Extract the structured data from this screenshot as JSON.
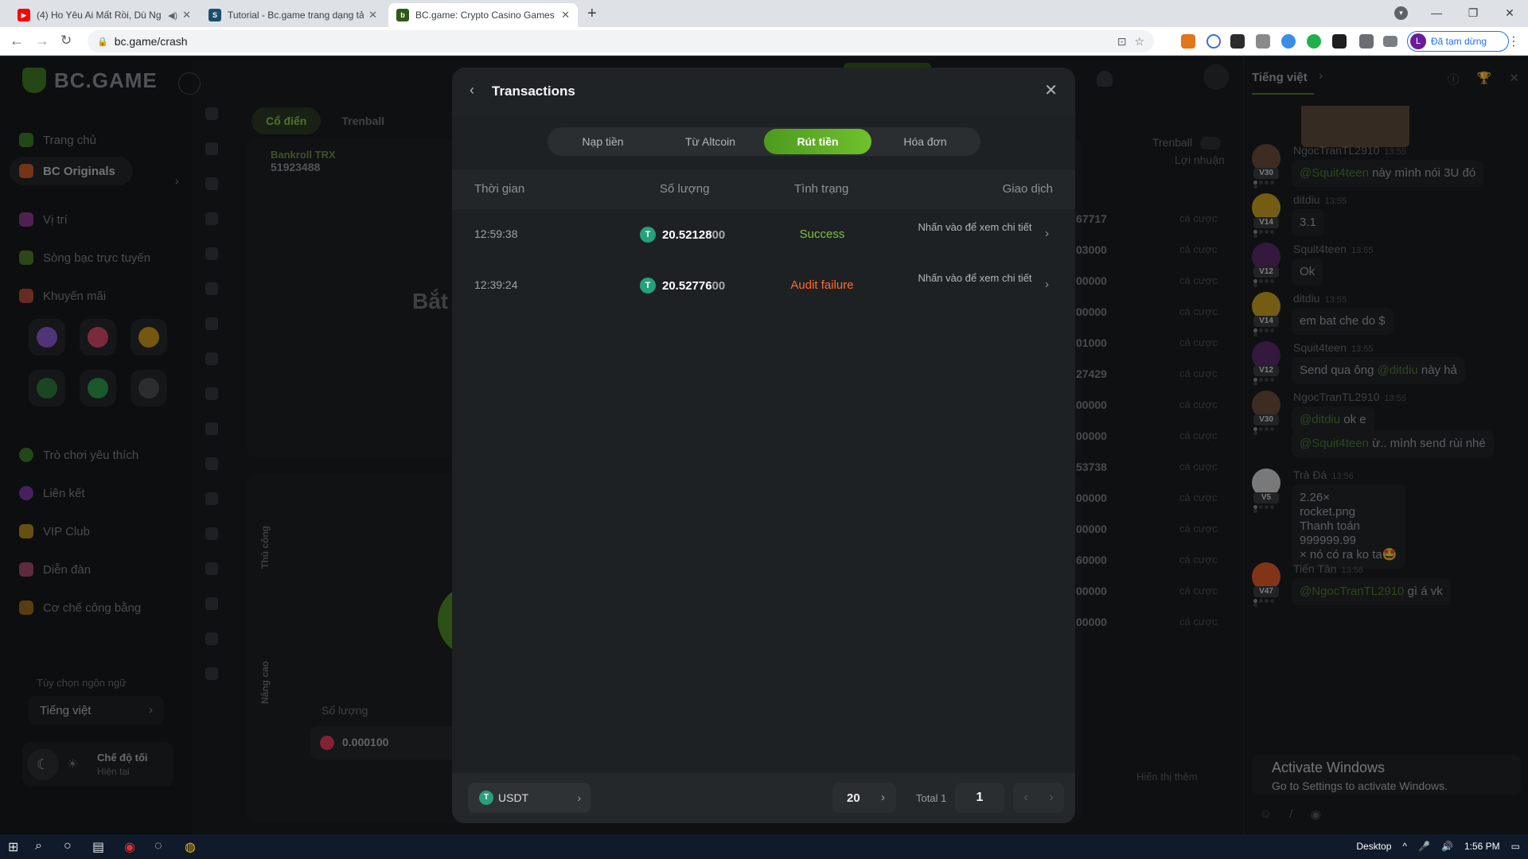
{
  "browser": {
    "tabs": [
      {
        "title": "(4) Ho Yêu Ai Mất Rồi, Dù Ng",
        "favicon_color": "#ff0000",
        "favicon_glyph": "▶"
      },
      {
        "title": "Tutorial - Bc.game trang dạng tả",
        "favicon_color": "#1e4d6b",
        "favicon_glyph": "S"
      },
      {
        "title": "BC.game: Crypto Casino Games &",
        "favicon_color": "#2d5a1b",
        "favicon_glyph": "b"
      }
    ],
    "url": "bc.game/crash",
    "profile_initial": "L",
    "profile_label": "Đã tạm dừng"
  },
  "sidebar": {
    "logo": "BC.GAME",
    "items": [
      {
        "label": "Trang chủ",
        "icon": "home-icon",
        "color": "#3b7d2a"
      },
      {
        "label": "BC Originals",
        "icon": "originals-icon",
        "color": "#c75a28"
      },
      {
        "label": "Vị trí",
        "icon": "slots-icon",
        "color": "#8a3a8a"
      },
      {
        "label": "Sòng bạc trực tuyến",
        "icon": "casino-icon",
        "color": "#4f7a2c"
      },
      {
        "label": "Khuyến mãi",
        "icon": "promo-icon",
        "color": "#b04a3a"
      },
      {
        "label": "Trò chơi yêu thích",
        "icon": "favorite-icon",
        "color": "#3b7d2a"
      },
      {
        "label": "Liên kết",
        "icon": "link-icon",
        "color": "#7a3aa0"
      },
      {
        "label": "VIP Club",
        "icon": "crown-icon",
        "color": "#b08820"
      },
      {
        "label": "Diễn đàn",
        "icon": "forum-icon",
        "color": "#a04a6a"
      },
      {
        "label": "Cơ chế công bằng",
        "icon": "fairness-icon",
        "color": "#9a6a20"
      }
    ],
    "lang_label": "Tùy chọn ngôn ngữ",
    "lang_value": "Tiếng việt",
    "theme_title": "Chế độ tối",
    "theme_sub": "Hiện tại"
  },
  "game": {
    "mode_tabs": [
      "Cổ điển",
      "Trenball"
    ],
    "bankroll_label": "Bankroll TRX",
    "bankroll_value": "51923488",
    "headline": "Bắt",
    "manual_label": "Thủ công",
    "advanced_label": "Nâng cao",
    "amount_label": "Số lượng",
    "amount_value": "0.000100",
    "trenball_label": "Trenball",
    "profit_header": "Lợi nhuận",
    "rows": [
      {
        "num": "67717",
        "note": "cá cược"
      },
      {
        "num": "03000",
        "note": "cá cược"
      },
      {
        "num": "00000",
        "note": "cá cược"
      },
      {
        "num": "00000",
        "note": "cá cược"
      },
      {
        "num": "01000",
        "note": "cá cược"
      },
      {
        "num": "27429",
        "note": "cá cược"
      },
      {
        "num": "00000",
        "note": "cá cược"
      },
      {
        "num": "00000",
        "note": "cá cược"
      },
      {
        "num": "53738",
        "note": "cá cược"
      },
      {
        "num": "00000",
        "note": "cá cược"
      },
      {
        "num": "00000",
        "note": "cá cược"
      },
      {
        "num": "60000",
        "note": "cá cược"
      },
      {
        "num": "00000",
        "note": "cá cược"
      },
      {
        "num": "00000",
        "note": "cá cược"
      }
    ],
    "show_more": "Hiển thị thêm"
  },
  "chat": {
    "lang": "Tiếng việt",
    "messages": [
      {
        "name": "NgocTranTL2910",
        "time": "13:55",
        "lvl": "V30",
        "avatar": "#6b4a3a",
        "mention": "@Squit4teen",
        "text": " này mình nói 3U đó"
      },
      {
        "name": "ditdiu",
        "time": "13:55",
        "lvl": "V14",
        "avatar": "#c8a020",
        "mention": "",
        "text": "3.1"
      },
      {
        "name": "Squit4teen",
        "time": "13:55",
        "lvl": "V12",
        "avatar": "#5a2a6a",
        "mention": "",
        "text": "Ok"
      },
      {
        "name": "ditdiu",
        "time": "13:55",
        "lvl": "V14",
        "avatar": "#c8a020",
        "mention": "",
        "text": "em bat che do $"
      },
      {
        "name": "Squit4teen",
        "time": "13:55",
        "lvl": "V12",
        "avatar": "#5a2a6a",
        "mention": "",
        "text": "Send qua ông ",
        "mention_after": "@ditdiu",
        "text_after": " này hả"
      },
      {
        "name": "NgocTranTL2910",
        "time": "13:55",
        "lvl": "V30",
        "avatar": "#6b4a3a",
        "mention": "@ditdiu",
        "text": " ok e"
      },
      {
        "name": "",
        "time": "",
        "lvl": "",
        "avatar": "",
        "mention": "@Squit4teen",
        "text": " ừ.. mình send rùi nhé"
      },
      {
        "name": "Trà Đá",
        "time": "13:56",
        "lvl": "V5",
        "avatar": "#d0d0d0",
        "mention": "",
        "text": "2.26×\nrocket.png\nThanh toán\n999999.99\n× nó có ra ko ta🤩"
      },
      {
        "name": "Tiến Tân",
        "time": "13:56",
        "lvl": "V47",
        "avatar": "#e05a2a",
        "mention": "@NgocTranTL2910",
        "text": " gì á vk"
      }
    ],
    "activate_title": "Activate Windows",
    "activate_sub": "Go to Settings to activate Windows."
  },
  "modal": {
    "title": "Transactions",
    "tabs": [
      {
        "label": "Nạp tiền",
        "active": false
      },
      {
        "label": "Từ Altcoin",
        "active": false
      },
      {
        "label": "Rút tiền",
        "active": true
      },
      {
        "label": "Hóa đơn",
        "active": false
      }
    ],
    "columns": [
      "Thời gian",
      "Số lượng",
      "Tình trạng",
      "Giao dịch"
    ],
    "rows": [
      {
        "time": "12:59:38",
        "amount_main": "20.52128",
        "amount_dim": "00",
        "status": "Success",
        "status_type": "ok",
        "detail": "Nhấn vào để xem chi tiết"
      },
      {
        "time": "12:39:24",
        "amount_main": "20.52776",
        "amount_dim": "00",
        "status": "Audit failure",
        "status_type": "fail",
        "detail": "Nhấn vào để xem chi tiết"
      }
    ],
    "currency": "USDT",
    "per_page": "20",
    "total_label": "Total 1",
    "page": "1"
  },
  "taskbar": {
    "desktop_label": "Desktop",
    "time": "1:56 PM"
  }
}
